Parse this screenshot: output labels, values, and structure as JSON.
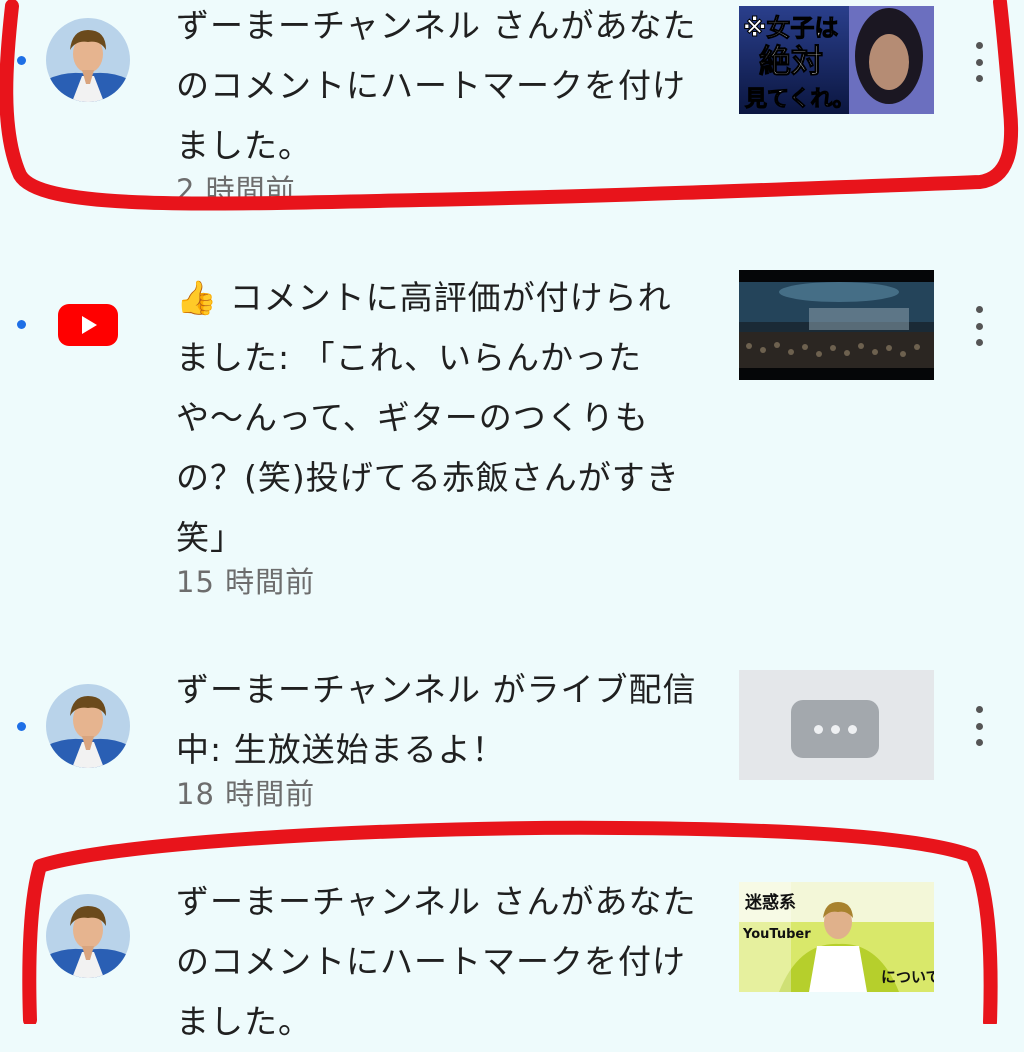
{
  "notifications": [
    {
      "text": "ずーまーチャンネル さんがあなたのコメントにハートマークを付けました。",
      "time": "2 時間前",
      "thumb_caption_1": "※女子は",
      "thumb_caption_2": "絶対",
      "thumb_caption_3": "見てくれ。"
    },
    {
      "emoji": "👍",
      "text": "コメントに高評価が付けられました: 「これ、いらんかったや〜んって、ギターのつくりもの？(笑)投げてる赤飯さんがすき笑」",
      "time": "15 時間前"
    },
    {
      "text": "ずーまーチャンネル がライブ配信中: 生放送始まるよ！",
      "time": "18 時間前"
    },
    {
      "text": "ずーまーチャンネル さんがあなたのコメントにハートマークを付けました。",
      "thumb_caption_1": "迷惑系",
      "thumb_caption_2": "YouTuber",
      "thumb_caption_3": "について"
    }
  ],
  "colors": {
    "background": "#eefbfc",
    "unread_dot": "#1e6fe6",
    "annotation_red": "#e8141b",
    "youtube_red": "#ff0000"
  }
}
